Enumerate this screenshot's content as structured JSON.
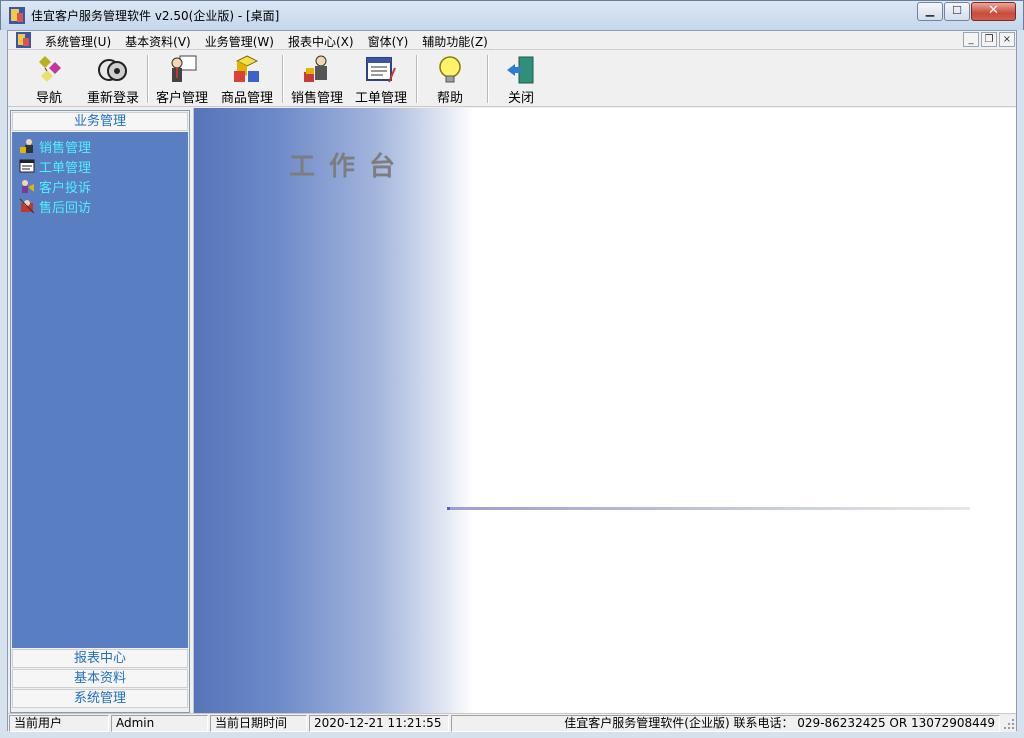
{
  "window": {
    "title": "佳宜客户服务管理软件 v2.50(企业版)  - [桌面]",
    "minimize_glyph": "▁",
    "maximize_glyph": "☐",
    "close_glyph": "✕"
  },
  "menubar": {
    "items": [
      "系统管理(U)",
      "基本资料(V)",
      "业务管理(W)",
      "报表中心(X)",
      "窗体(Y)",
      "辅助功能(Z)"
    ],
    "mdi_minimize": "_",
    "mdi_restore": "❐",
    "mdi_close": "×"
  },
  "toolbar": {
    "buttons": [
      {
        "label": "导航",
        "icon": "navigation-icon"
      },
      {
        "label": "重新登录",
        "icon": "relogin-icon"
      },
      {
        "label": "客户管理",
        "icon": "customer-icon"
      },
      {
        "label": "商品管理",
        "icon": "product-icon"
      },
      {
        "label": "销售管理",
        "icon": "sales-icon"
      },
      {
        "label": "工单管理",
        "icon": "workorder-icon"
      },
      {
        "label": "帮助",
        "icon": "lightbulb-icon"
      },
      {
        "label": "关闭",
        "icon": "exit-door-icon"
      }
    ]
  },
  "sidebar": {
    "active_group": "业务管理",
    "items": [
      {
        "label": "销售管理",
        "icon": "sales-icon"
      },
      {
        "label": "工单管理",
        "icon": "workorder-icon"
      },
      {
        "label": "客户投诉",
        "icon": "complaint-icon"
      },
      {
        "label": "售后回访",
        "icon": "revisit-icon"
      }
    ],
    "groups": [
      "报表中心",
      "基本资料",
      "系统管理"
    ]
  },
  "workspace": {
    "title": "工作台"
  },
  "statusbar": {
    "user_label": "当前用户",
    "user_value": "Admin",
    "date_label": "当前日期时间",
    "date_value": "2020-12-21 11:21:55",
    "info": "佳宜客户服务管理软件(企业版) 联系电话： 029-86232425   OR   13072908449"
  },
  "colors": {
    "sidebar_panel": "#5a7ec2",
    "sidebar_item_text": "#4ef0ff",
    "group_header_text": "#1f6fbf"
  }
}
